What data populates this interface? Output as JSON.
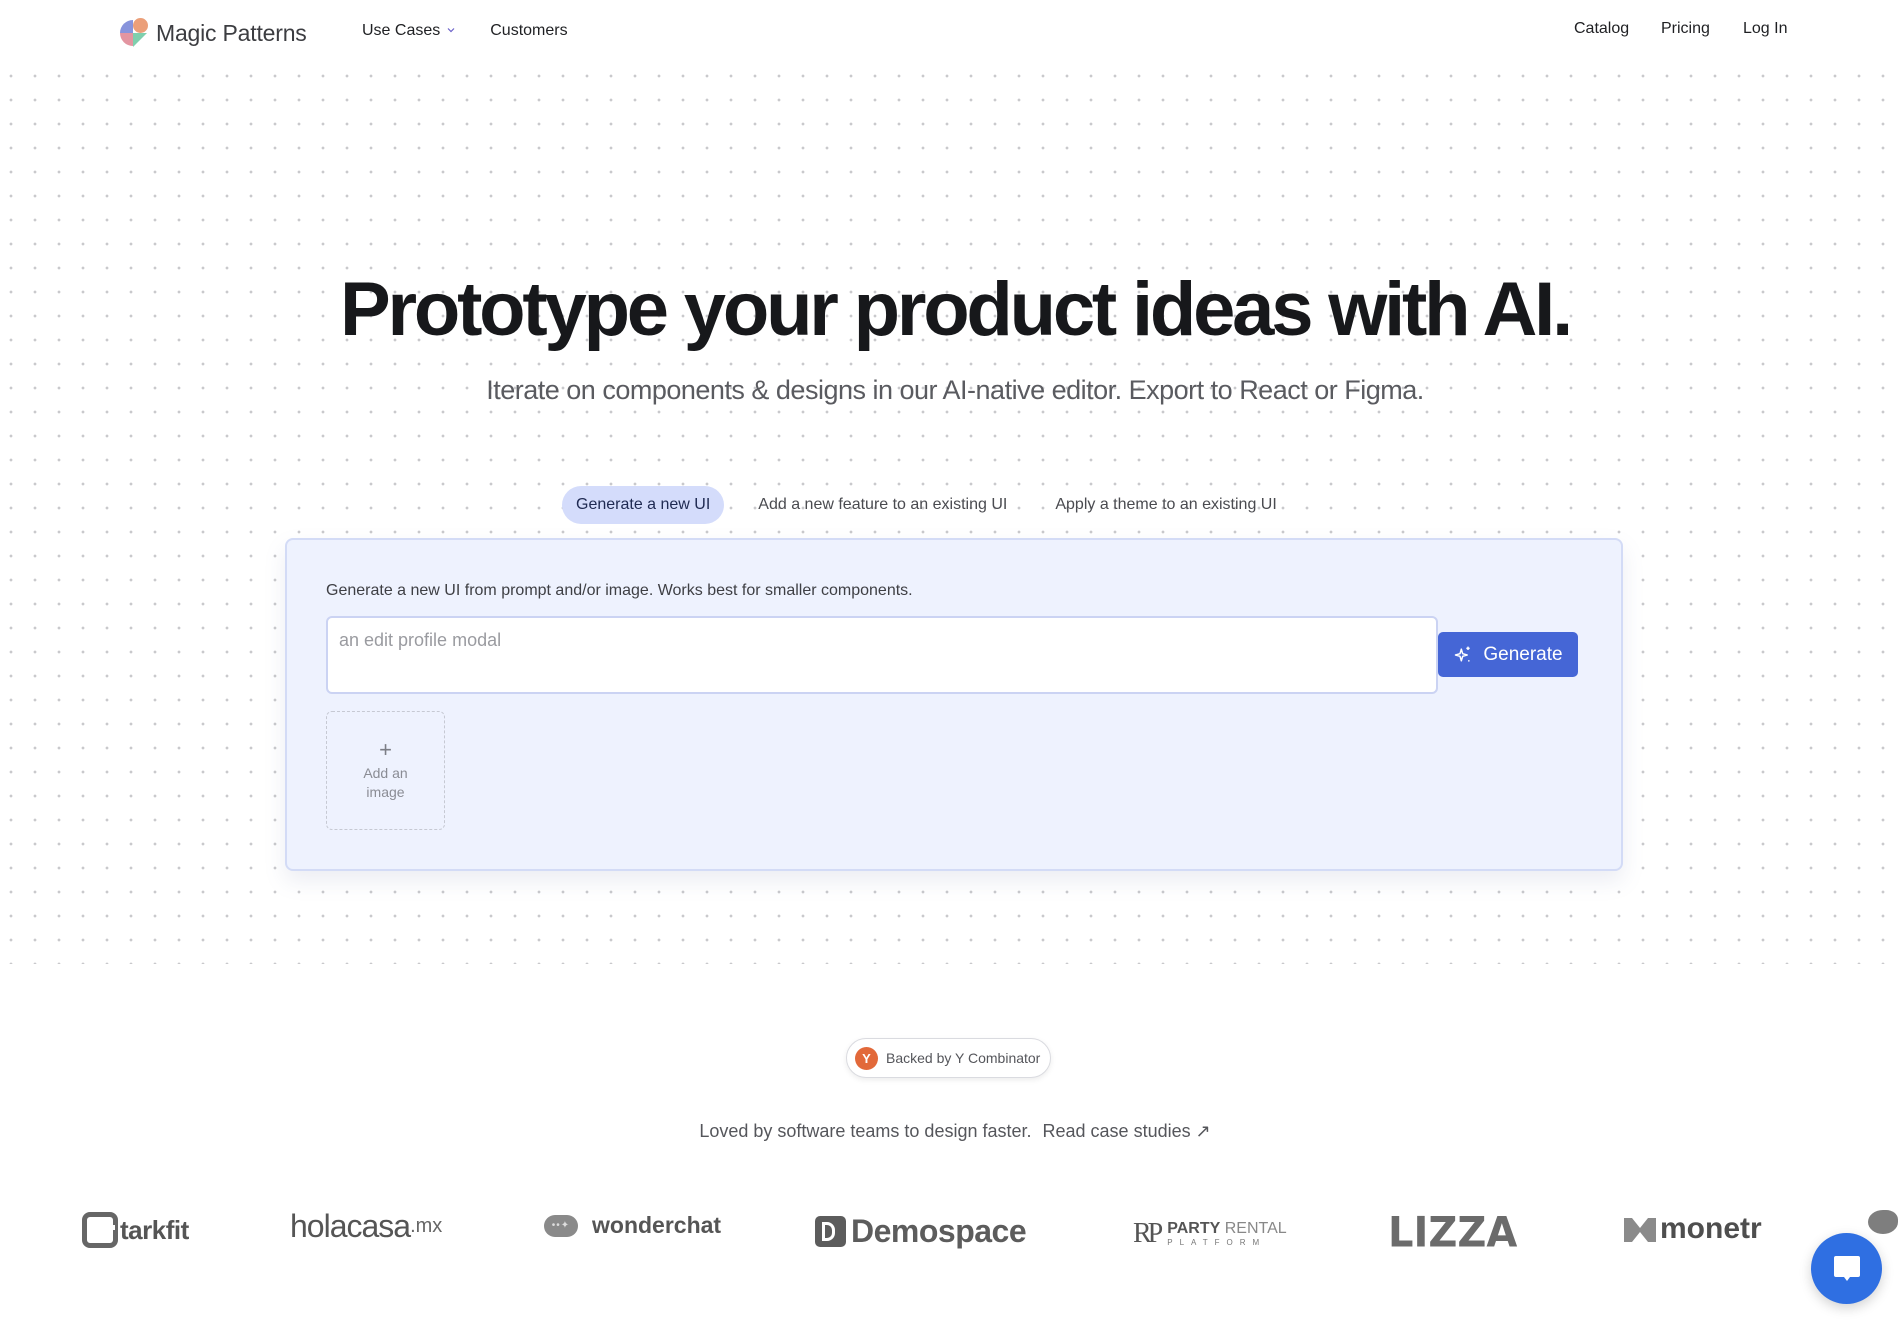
{
  "header": {
    "brand_name": "Magic Patterns",
    "nav_left": [
      {
        "label": "Use Cases",
        "has_dropdown": true
      },
      {
        "label": "Customers"
      }
    ],
    "nav_right": [
      {
        "label": "Catalog"
      },
      {
        "label": "Pricing"
      },
      {
        "label": "Log In"
      }
    ]
  },
  "hero": {
    "title": "Prototype your product ideas with AI.",
    "subtitle": "Iterate on components & designs in our AI-native editor. Export to React or Figma."
  },
  "tabs": [
    {
      "label": "Generate a new UI",
      "active": true
    },
    {
      "label": "Add a new feature to an existing UI",
      "active": false
    },
    {
      "label": "Apply a theme to an existing UI",
      "active": false
    }
  ],
  "generator": {
    "description": "Generate a new UI from prompt and/or image. Works best for smaller components.",
    "prompt_value": "",
    "prompt_placeholder": "an edit profile modal",
    "generate_label": "Generate",
    "add_image_icon": "+",
    "add_image_label": "Add an image"
  },
  "social_proof": {
    "yc_logo_letter": "Y",
    "yc_label": "Backed by Y Combinator",
    "loved_text": "Loved by software teams to design faster.",
    "case_studies_link": "Read case studies ↗"
  },
  "customer_logos": {
    "starkfit": "tarkfit",
    "holacasa": "holacasa",
    "holacasa_suffix": ".mx",
    "wonderchat": "wonderchat",
    "wonderchat_dots": "••✦",
    "demospace": "Demospace",
    "party_rp": "RP",
    "party_bold": "PARTY",
    "party_light": "RENTAL",
    "party_sub": "PLATFORM",
    "lizza": "LIZZA",
    "monetr": "monetr"
  },
  "colors": {
    "accent": "#4566d6",
    "tab_active_bg": "#d4dcfb",
    "card_bg": "#eef2fe",
    "yc_orange": "#e2693a",
    "chat_blue": "#2f6fe2"
  }
}
